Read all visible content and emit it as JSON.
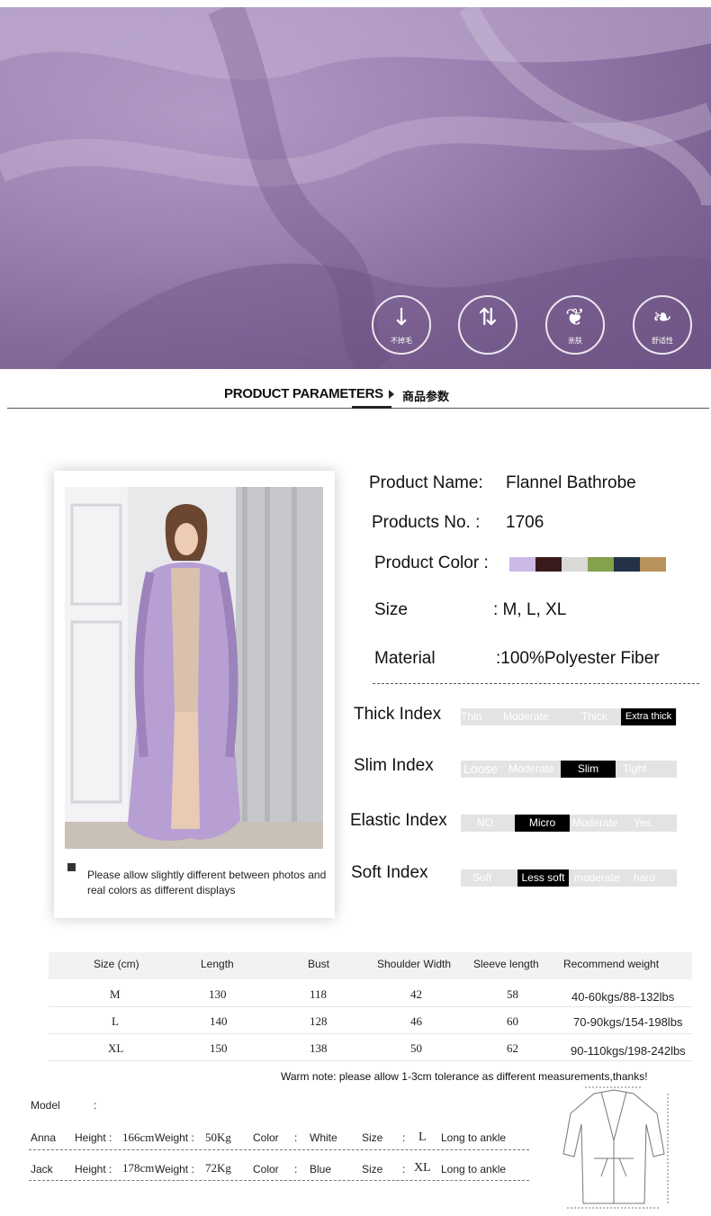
{
  "banner": {
    "features": [
      {
        "label": "不掉毛",
        "icon": "down-arrow-icon"
      },
      {
        "label": "",
        "icon": "air-flow-icon"
      },
      {
        "label": "亲肤",
        "icon": "feather-icon"
      },
      {
        "label": "舒适性",
        "icon": "leaf-icon"
      }
    ]
  },
  "section": {
    "title": "PRODUCT PARAMETERS",
    "cn": "商品参数"
  },
  "photo_note": "Please allow slightly different between photos and real colors as different displays",
  "params": {
    "name_label": "Product Name:",
    "name_value": "Flannel Bathrobe",
    "no_label": "Products No. :",
    "no_value": "1706",
    "color_label": "Product Color :",
    "colors": [
      "#cdb8e6",
      "#3a1b1c",
      "#d9d9d6",
      "#84a14c",
      "#243247",
      "#b8925a"
    ],
    "size_label": "Size",
    "size_value": ":  M,  L,  XL",
    "material_label": "Material",
    "material_value": ":100%Polyester Fiber"
  },
  "indexes": [
    {
      "label": "Thick Index",
      "options": [
        "Thin",
        "Moderate",
        "Thick",
        "Extra thick"
      ],
      "selected": "Extra thick"
    },
    {
      "label": "Slim Index",
      "options": [
        "Loose",
        "Moderate",
        "Slim",
        "Tight"
      ],
      "selected": "Slim"
    },
    {
      "label": "Elastic Index",
      "options": [
        "NO",
        "Micro",
        "Moderate",
        "Yes"
      ],
      "selected": "Micro"
    },
    {
      "label": "Soft Index",
      "options": [
        "Soft",
        "Less soft",
        "moderate",
        "hard"
      ],
      "selected": "Less soft"
    }
  ],
  "size_table": {
    "headers": [
      "Size (cm)",
      "Length",
      "Bust",
      "Shoulder Width",
      "Sleeve length",
      "Recommend weight"
    ],
    "rows": [
      [
        "M",
        "130",
        "118",
        "42",
        "58",
        "40-60kgs/88-132lbs"
      ],
      [
        "L",
        "140",
        "128",
        "46",
        "60",
        "70-90kgs/154-198lbs"
      ],
      [
        "XL",
        "150",
        "138",
        "50",
        "62",
        "90-110kgs/198-242lbs"
      ]
    ],
    "warm_note": "Warm note: please allow 1-3cm tolerance as different  measurements,thanks!"
  },
  "models": {
    "header_label": "Model",
    "header_colon": ":",
    "rows": [
      {
        "name": "Anna",
        "height_label": "Height :",
        "height": "166cm",
        "weight_label": "Weight :",
        "weight": "50Kg",
        "color_label": "Color",
        "color_sep": ":",
        "color": "White",
        "size_label": "Size",
        "size_sep": ":",
        "size": "L",
        "fit": "Long to ankle"
      },
      {
        "name": "Jack",
        "height_label": "Height :",
        "height": "178cm",
        "weight_label": "Weight :",
        "weight": "72Kg",
        "color_label": "Color",
        "color_sep": ":",
        "color": "Blue",
        "size_label": "Size",
        "size_sep": ":",
        "size": "XL",
        "fit": "Long to ankle"
      }
    ]
  }
}
